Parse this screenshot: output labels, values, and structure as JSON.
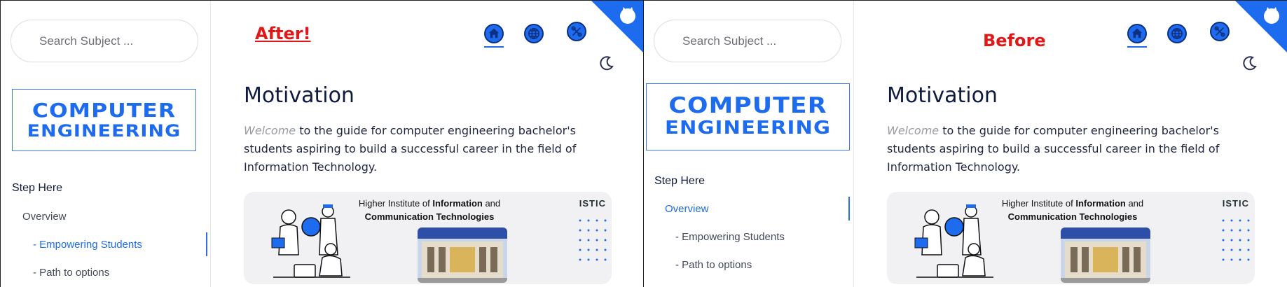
{
  "after": {
    "tag": "After!",
    "search_placeholder": "Search Subject ...",
    "logo_line1": "COMPUTER",
    "logo_line2": "ENGINEERING",
    "nav": {
      "heading": "Step Here",
      "items": [
        {
          "label": "Overview",
          "active": false
        },
        {
          "label": "- Empowering Students",
          "active": true
        },
        {
          "label": "- Path to options",
          "active": false
        }
      ]
    },
    "page_title": "Motivation",
    "intro_word": "Welcome",
    "intro_rest": " to the guide for computer engineering bachelor's students aspiring to build a successful career in the field of Information Technology.",
    "banner": {
      "line1_pre": "Higher Institute of ",
      "line1_bold": "Information",
      "line1_post": " and",
      "line2": "Communication Technologies",
      "brand": "ISTIC"
    }
  },
  "before": {
    "tag": "Before",
    "search_placeholder": "Search Subject ...",
    "logo_line1": "COMPUTER",
    "logo_line2": "ENGINEERING",
    "nav": {
      "heading": "Step Here",
      "items": [
        {
          "label": "Overview",
          "active": true
        },
        {
          "label": "- Empowering Students",
          "active": false
        },
        {
          "label": "- Path to options",
          "active": false
        }
      ]
    },
    "page_title": "Motivation",
    "intro_word": "Welcome",
    "intro_rest": " to the guide for computer engineering bachelor's students aspiring to build a successful career in the field of Information Technology.",
    "banner": {
      "line1_pre": "Higher Institute of ",
      "line1_bold": "Information",
      "line1_post": " and",
      "line2": "Communication Technologies",
      "brand": "ISTIC"
    }
  },
  "icons": {
    "home": "home-icon",
    "globe": "globe-icon",
    "tools": "tools-icon",
    "theme": "moon-icon",
    "corner": "github-corner-icon"
  },
  "colors": {
    "accent": "#1d6bee",
    "label_red": "#e11818",
    "text_dark": "#0f1a40"
  }
}
